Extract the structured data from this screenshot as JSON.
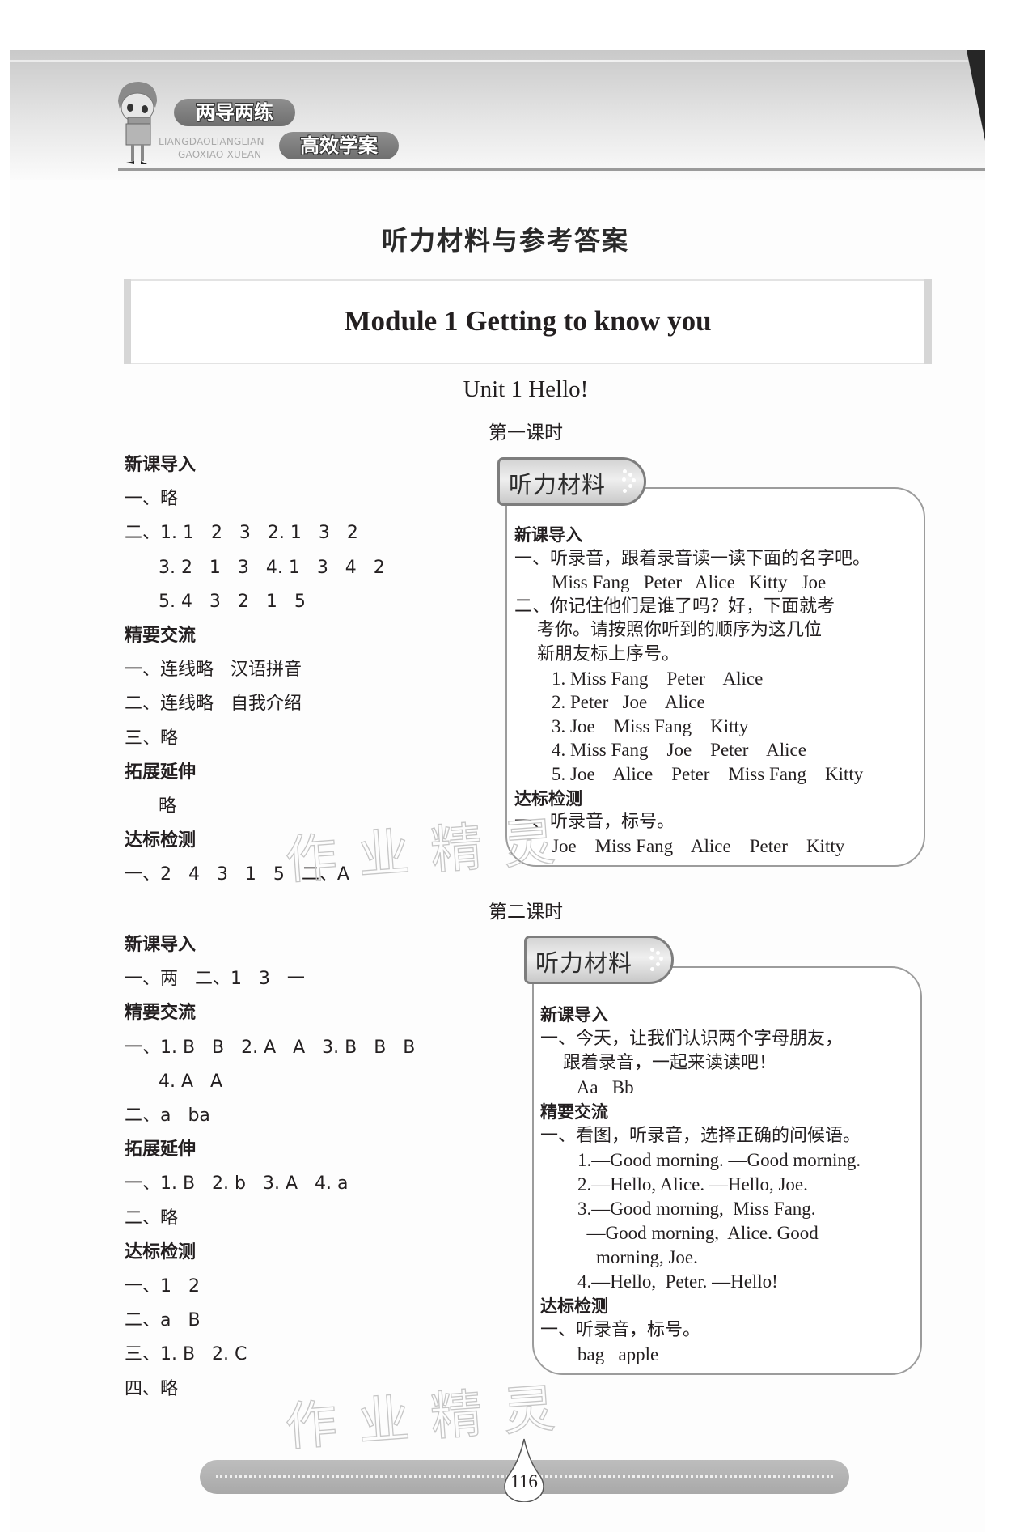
{
  "header": {
    "brand_cn_1": "两导两练",
    "brand_cn_2": "高效学案",
    "brand_en_1": "LIANGDAOLIANGLIAN",
    "brand_en_2": "GAOXIAO XUEAN"
  },
  "doc_title": "听力材料与参考答案",
  "module_title": "Module 1 Getting to know you",
  "unit_title": "Unit 1 Hello!",
  "watermark": "作业精灵",
  "lesson1": {
    "title": "第一课时",
    "answers": [
      {
        "type": "heading",
        "text": "新课导入"
      },
      {
        "type": "line",
        "text": "一、略"
      },
      {
        "type": "line",
        "text": "二、1. 1   2   3   2. 1   3   2"
      },
      {
        "type": "line",
        "text": "      3. 2   1   3   4. 1   3   4   2"
      },
      {
        "type": "line",
        "text": "      5. 4   3   2   1   5"
      },
      {
        "type": "heading",
        "text": "精要交流"
      },
      {
        "type": "line",
        "text": "一、连线略   汉语拼音"
      },
      {
        "type": "line",
        "text": "二、连线略   自我介绍"
      },
      {
        "type": "line",
        "text": "三、略"
      },
      {
        "type": "heading",
        "text": "拓展延伸"
      },
      {
        "type": "line",
        "text": "      略"
      },
      {
        "type": "heading",
        "text": "达标检测"
      },
      {
        "type": "line",
        "text": "一、2   4   3   1   5   二、A"
      }
    ],
    "material": {
      "tab_label": "听力材料",
      "lines": [
        {
          "type": "heading",
          "text": "新课导入"
        },
        {
          "type": "cn",
          "text": "一、听录音，跟着录音读一读下面的名字吧。"
        },
        {
          "type": "en",
          "text": "        Miss Fang   Peter   Alice   Kitty   Joe"
        },
        {
          "type": "cn",
          "text": "二、你记住他们是谁了吗？好，下面就考"
        },
        {
          "type": "cn",
          "text": "    考你。请按照你听到的顺序为这几位"
        },
        {
          "type": "cn",
          "text": "    新朋友标上序号。"
        },
        {
          "type": "en",
          "text": "        1. Miss Fang    Peter    Alice"
        },
        {
          "type": "en",
          "text": "        2. Peter   Joe    Alice"
        },
        {
          "type": "en",
          "text": "        3. Joe    Miss Fang    Kitty"
        },
        {
          "type": "en",
          "text": "        4. Miss Fang    Joe    Peter    Alice"
        },
        {
          "type": "en",
          "text": "        5. Joe    Alice    Peter    Miss Fang    Kitty"
        },
        {
          "type": "heading",
          "text": "达标检测"
        },
        {
          "type": "cn",
          "text": "一、听录音，标号。"
        },
        {
          "type": "en",
          "text": "        Joe    Miss Fang    Alice    Peter    Kitty"
        }
      ]
    }
  },
  "lesson2": {
    "title": "第二课时",
    "answers": [
      {
        "type": "heading",
        "text": "新课导入"
      },
      {
        "type": "line",
        "text": "一、两   二、1   3   一"
      },
      {
        "type": "heading",
        "text": "精要交流"
      },
      {
        "type": "line",
        "text": "一、1. B   B   2. A   A   3. B   B   B"
      },
      {
        "type": "line",
        "text": "      4. A   A"
      },
      {
        "type": "line",
        "text": "二、a   ba"
      },
      {
        "type": "heading",
        "text": "拓展延伸"
      },
      {
        "type": "line",
        "text": "一、1. B   2. b   3. A   4. a"
      },
      {
        "type": "line",
        "text": "二、略"
      },
      {
        "type": "heading",
        "text": "达标检测"
      },
      {
        "type": "line",
        "text": "一、1   2"
      },
      {
        "type": "line",
        "text": "二、a   B"
      },
      {
        "type": "line",
        "text": "三、1. B   2. C"
      },
      {
        "type": "line",
        "text": "四、略"
      }
    ],
    "material": {
      "tab_label": "听力材料",
      "lines": [
        {
          "type": "heading",
          "text": "新课导入"
        },
        {
          "type": "cn",
          "text": "一、今天，让我们认识两个字母朋友，"
        },
        {
          "type": "cn",
          "text": "    跟着录音，一起来读读吧！"
        },
        {
          "type": "en",
          "text": "        Aa   Bb"
        },
        {
          "type": "heading",
          "text": "精要交流"
        },
        {
          "type": "cn",
          "text": "一、看图，听录音，选择正确的问候语。"
        },
        {
          "type": "en",
          "text": "        1.—Good morning. —Good morning."
        },
        {
          "type": "en",
          "text": "        2.—Hello, Alice. —Hello, Joe."
        },
        {
          "type": "en",
          "text": "        3.—Good morning,  Miss Fang."
        },
        {
          "type": "en",
          "text": "          —Good morning,  Alice. Good"
        },
        {
          "type": "en",
          "text": "            morning, Joe."
        },
        {
          "type": "en",
          "text": "        4.—Hello,  Peter. —Hello!"
        },
        {
          "type": "heading",
          "text": "达标检测"
        },
        {
          "type": "cn",
          "text": "一、听录音，标号。"
        },
        {
          "type": "en",
          "text": "        bag   apple"
        }
      ]
    }
  },
  "footer": {
    "page_number": "116"
  }
}
